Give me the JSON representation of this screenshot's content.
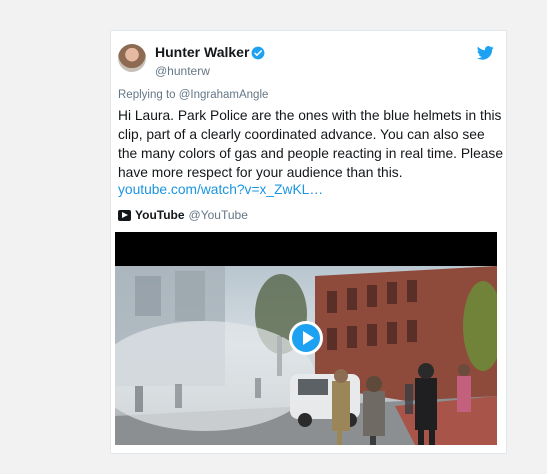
{
  "tweet": {
    "author_name": "Hunter Walker",
    "author_handle": "@hunterw",
    "reply_context": "Replying to @IngrahamAngle",
    "text": "Hi Laura. Park Police are the ones with the blue helmets in this clip, part of a clearly coordinated advance. You can also see the many colors of gas and people reacting in real time. Please have more respect for your audience than this.",
    "link_text": "youtube.com/watch?v=x_ZwKL…"
  },
  "embed": {
    "source_name": "YouTube",
    "source_handle": "@YouTube"
  },
  "colors": {
    "link": "#1b95e0",
    "brand": "#1da1f2",
    "verified": "#1da1f2"
  },
  "icons": {
    "verified": "verified-badge-icon",
    "brand": "twitter-bird-icon",
    "source": "youtube-icon",
    "play": "play-icon"
  }
}
